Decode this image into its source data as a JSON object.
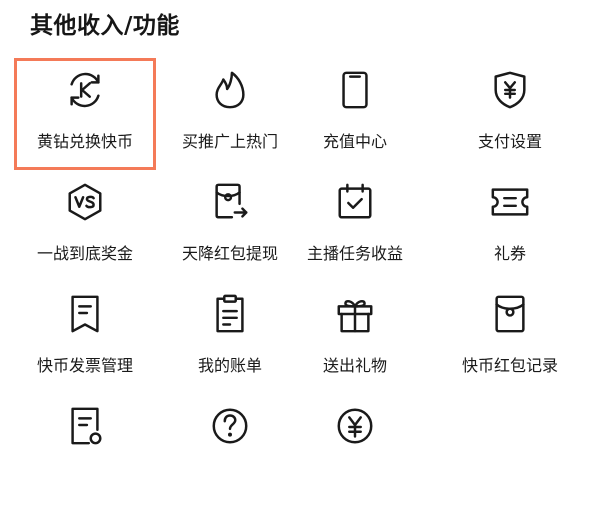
{
  "section": {
    "title": "其他收入/功能"
  },
  "items": [
    {
      "label": "黄钻兑换快币",
      "icon": "exchange-k-icon"
    },
    {
      "label": "买推广上热门",
      "icon": "flame-icon"
    },
    {
      "label": "充值中心",
      "icon": "phone-icon"
    },
    {
      "label": "支付设置",
      "icon": "shield-yen-icon"
    },
    {
      "label": "一战到底奖金",
      "icon": "vs-badge-icon"
    },
    {
      "label": "天降红包提现",
      "icon": "withdraw-icon"
    },
    {
      "label": "主播任务收益",
      "icon": "calendar-check-icon"
    },
    {
      "label": "礼券",
      "icon": "ticket-icon"
    },
    {
      "label": "快币发票管理",
      "icon": "invoice-icon"
    },
    {
      "label": "我的账单",
      "icon": "bill-icon"
    },
    {
      "label": "送出礼物",
      "icon": "gift-icon"
    },
    {
      "label": "快币红包记录",
      "icon": "red-packet-icon"
    },
    {
      "label": "",
      "icon": "document-coin-icon"
    },
    {
      "label": "",
      "icon": "help-icon"
    },
    {
      "label": "",
      "icon": "yen-coin-icon"
    }
  ],
  "highlight_color": "#f47a58"
}
